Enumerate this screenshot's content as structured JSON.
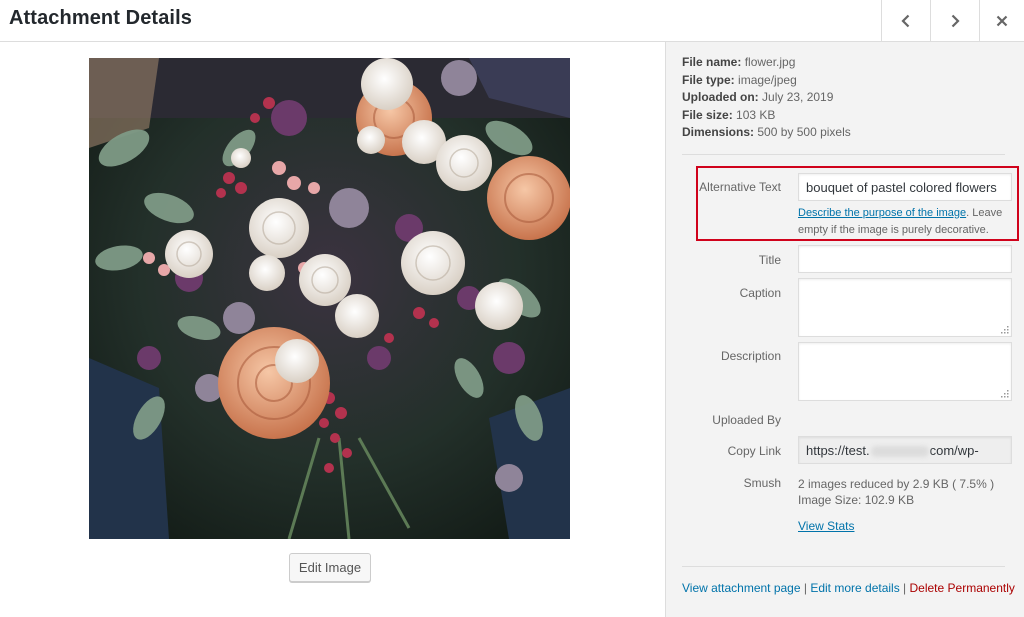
{
  "header": {
    "title": "Attachment Details"
  },
  "media": {
    "image_alt": "bouquet of pastel colored flowers",
    "edit_button": "Edit Image"
  },
  "file_info": [
    {
      "label": "File name:",
      "value": "flower.jpg"
    },
    {
      "label": "File type:",
      "value": "image/jpeg"
    },
    {
      "label": "Uploaded on:",
      "value": "July 23, 2019"
    },
    {
      "label": "File size:",
      "value": "103 KB"
    },
    {
      "label": "Dimensions:",
      "value": "500 by 500 pixels"
    }
  ],
  "fields": {
    "alt_text": {
      "label": "Alternative Text",
      "value": "bouquet of pastel colored flowers"
    },
    "alt_help_link": "Describe the purpose of the image",
    "alt_help_rest": ". Leave empty if the image is purely decorative.",
    "title": {
      "label": "Title",
      "value": ""
    },
    "caption": {
      "label": "Caption",
      "value": ""
    },
    "description": {
      "label": "Description",
      "value": ""
    },
    "uploaded_by": {
      "label": "Uploaded By",
      "value": ""
    },
    "copy_link": {
      "label": "Copy Link",
      "value_start": "https://test.",
      "value_end": "com/wp-"
    }
  },
  "smush": {
    "label": "Smush",
    "line1": "2 images reduced by 2.9 KB ( 7.5% )",
    "line2": "Image Size: 102.9 KB",
    "view_stats": "View Stats"
  },
  "actions": {
    "view_page": "View attachment page",
    "separator": " | ",
    "edit_details": "Edit more details",
    "delete": "Delete Permanently"
  },
  "colors": {
    "highlight": "#d0021b",
    "link": "#0073aa",
    "delete": "#aa0000"
  }
}
